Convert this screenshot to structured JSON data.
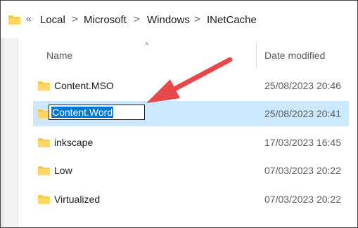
{
  "breadcrumb": {
    "overflow_glyph": "«",
    "items": [
      {
        "label": "Local"
      },
      {
        "label": "Microsoft"
      },
      {
        "label": "Windows"
      },
      {
        "label": "INetCache"
      }
    ],
    "separator": ">"
  },
  "columns": {
    "name": "Name",
    "date_modified": "Date modified",
    "sort_indicator": "^"
  },
  "files": [
    {
      "name": "Content.MSO",
      "date": "25/08/2023 20:46",
      "selected": false
    },
    {
      "name": "Content.Word",
      "date": "25/08/2023 20:41",
      "selected": true,
      "renaming": true
    },
    {
      "name": "inkscape",
      "date": "17/03/2023 16:45",
      "selected": false
    },
    {
      "name": "Low",
      "date": "07/03/2023 20:22",
      "selected": false
    },
    {
      "name": "Virtualized",
      "date": "07/03/2023 20:22",
      "selected": false
    }
  ],
  "colors": {
    "selection_row": "#cce8ff",
    "rename_highlight": "#0078d4",
    "annotation_arrow": "#e8484a",
    "folder": "#f6c94d"
  },
  "icons": {
    "folder": "folder-icon",
    "annotation": "red-arrow-pointer"
  }
}
